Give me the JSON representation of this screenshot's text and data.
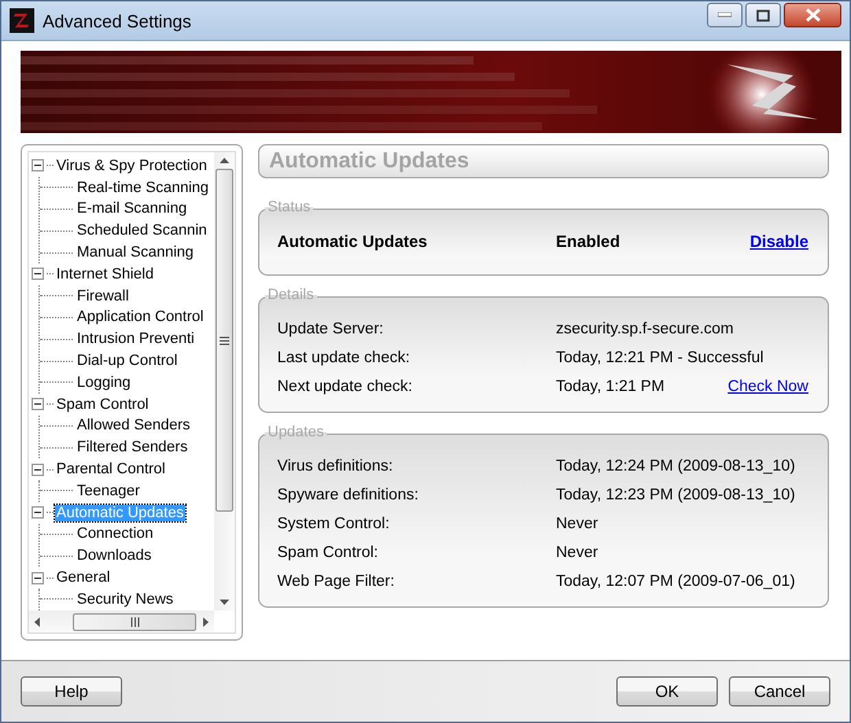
{
  "window": {
    "title": "Advanced Settings"
  },
  "tree": {
    "items": [
      {
        "label": "Virus & Spy Protection",
        "expanded": true,
        "selected": false,
        "children": [
          {
            "label": "Real-time Scanning",
            "selected": false
          },
          {
            "label": "E-mail Scanning",
            "selected": false
          },
          {
            "label": "Scheduled Scannin",
            "selected": false
          },
          {
            "label": "Manual Scanning",
            "selected": false
          }
        ]
      },
      {
        "label": "Internet Shield",
        "expanded": true,
        "selected": false,
        "children": [
          {
            "label": "Firewall",
            "selected": false
          },
          {
            "label": "Application Control",
            "selected": false
          },
          {
            "label": "Intrusion Preventi",
            "selected": false
          },
          {
            "label": "Dial-up Control",
            "selected": false
          },
          {
            "label": "Logging",
            "selected": false
          }
        ]
      },
      {
        "label": "Spam Control",
        "expanded": true,
        "selected": false,
        "children": [
          {
            "label": "Allowed Senders",
            "selected": false
          },
          {
            "label": "Filtered Senders",
            "selected": false
          }
        ]
      },
      {
        "label": "Parental Control",
        "expanded": true,
        "selected": false,
        "children": [
          {
            "label": "Teenager",
            "selected": false
          }
        ]
      },
      {
        "label": "Automatic Updates",
        "expanded": true,
        "selected": true,
        "children": [
          {
            "label": "Connection",
            "selected": false
          },
          {
            "label": "Downloads",
            "selected": false
          }
        ]
      },
      {
        "label": "General",
        "expanded": true,
        "selected": false,
        "children": [
          {
            "label": "Security News",
            "selected": false
          }
        ]
      }
    ]
  },
  "page": {
    "title": "Automatic Updates"
  },
  "status": {
    "legend": "Status",
    "label": "Automatic Updates",
    "value": "Enabled",
    "link": "Disable"
  },
  "details": {
    "legend": "Details",
    "rows": [
      {
        "label": "Update Server:",
        "value": "zsecurity.sp.f-secure.com"
      },
      {
        "label": "Last update check:",
        "value": "Today, 12:21 PM - Successful"
      },
      {
        "label": "Next update check:",
        "value": "Today, 1:21 PM",
        "link": "Check Now"
      }
    ]
  },
  "updates": {
    "legend": "Updates",
    "rows": [
      {
        "label": "Virus definitions:",
        "value": "Today, 12:24 PM (2009-08-13_10)"
      },
      {
        "label": "Spyware definitions:",
        "value": "Today, 12:23 PM (2009-08-13_10)"
      },
      {
        "label": "System Control:",
        "value": "Never"
      },
      {
        "label": "Spam Control:",
        "value": "Never"
      },
      {
        "label": "Web Page Filter:",
        "value": "Today, 12:07 PM (2009-07-06_01)"
      }
    ]
  },
  "left_buttons": [
    {
      "label": "Help"
    }
  ],
  "right_buttons": [
    {
      "label": "OK"
    },
    {
      "label": "Cancel"
    }
  ]
}
